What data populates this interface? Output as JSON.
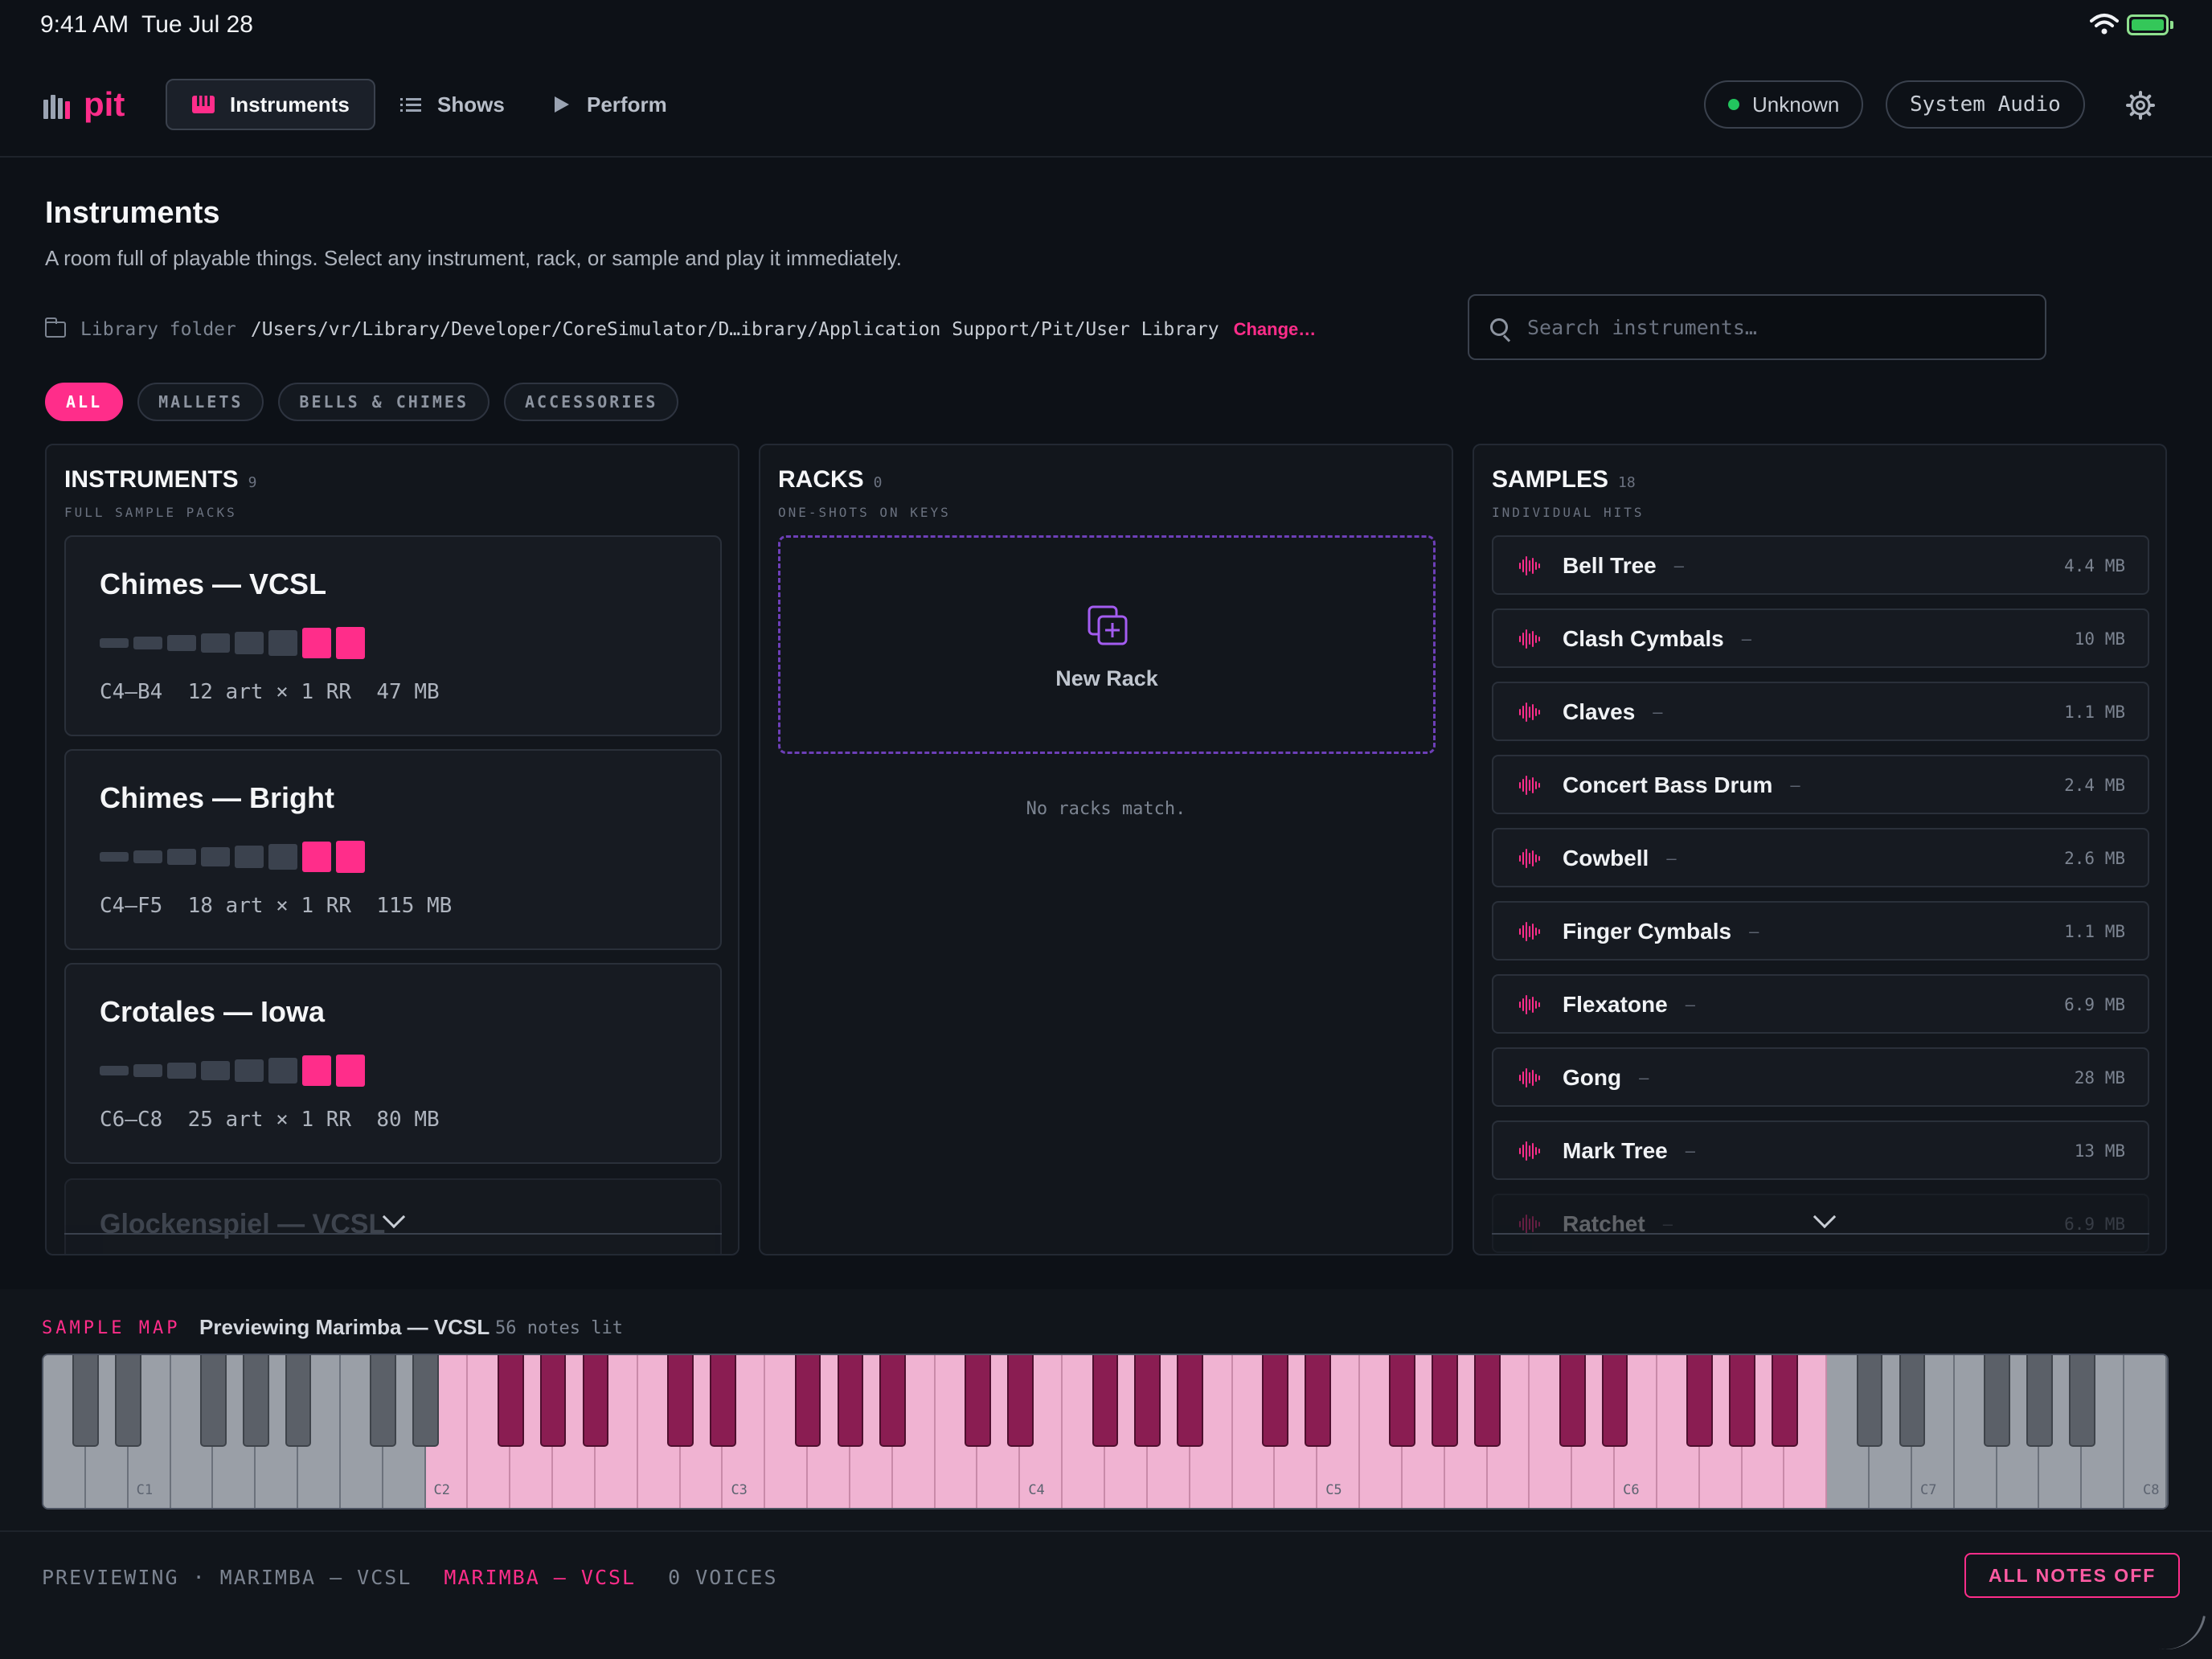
{
  "status": {
    "time": "9:41 AM",
    "date": "Tue Jul 28"
  },
  "nav": {
    "logo": "pit",
    "tabs": [
      {
        "label": "Instruments"
      },
      {
        "label": "Shows"
      },
      {
        "label": "Perform"
      }
    ],
    "connection_label": "Unknown",
    "audio_label": "System Audio",
    "accent_color": "#ff2d8a",
    "status_dot_color": "#22c55e"
  },
  "page": {
    "title": "Instruments",
    "subtitle": "A room full of playable things. Select any instrument, rack, or sample and play it immediately."
  },
  "library": {
    "label": "Library folder",
    "path": "/Users/vr/Library/Developer/CoreSimulator/D…ibrary/Application Support/Pit/User Library",
    "change_label": "Change…"
  },
  "search": {
    "placeholder": "Search instruments…",
    "value": ""
  },
  "filters": [
    {
      "label": "ALL",
      "active": true
    },
    {
      "label": "MALLETS",
      "active": false
    },
    {
      "label": "BELLS & CHIMES",
      "active": false
    },
    {
      "label": "ACCESSORIES",
      "active": false
    }
  ],
  "instruments_panel": {
    "title": "INSTRUMENTS",
    "count": "9",
    "caption": "FULL SAMPLE PACKS",
    "items": [
      {
        "name": "Chimes — VCSL",
        "range": "C4–B4",
        "articulations": "12 art × 1 RR",
        "size": "47 MB"
      },
      {
        "name": "Chimes — Bright",
        "range": "C4–F5",
        "articulations": "18 art × 1 RR",
        "size": "115 MB"
      },
      {
        "name": "Crotales — Iowa",
        "range": "C6–C8",
        "articulations": "25 art × 1 RR",
        "size": "80 MB"
      }
    ],
    "partial_item": "Glockenspiel — VCSL"
  },
  "racks_panel": {
    "title": "RACKS",
    "count": "0",
    "caption": "ONE-SHOTS ON KEYS",
    "new_label": "New Rack",
    "empty_text": "No racks match."
  },
  "samples_panel": {
    "title": "SAMPLES",
    "count": "18",
    "caption": "INDIVIDUAL HITS",
    "items": [
      {
        "name": "Bell Tree",
        "dash": "–",
        "size": "4.4 MB"
      },
      {
        "name": "Clash Cymbals",
        "dash": "–",
        "size": "10 MB"
      },
      {
        "name": "Claves",
        "dash": "–",
        "size": "1.1 MB"
      },
      {
        "name": "Concert Bass Drum",
        "dash": "–",
        "size": "2.4 MB"
      },
      {
        "name": "Cowbell",
        "dash": "–",
        "size": "2.6 MB"
      },
      {
        "name": "Finger Cymbals",
        "dash": "–",
        "size": "1.1 MB"
      },
      {
        "name": "Flexatone",
        "dash": "–",
        "size": "6.9 MB"
      },
      {
        "name": "Gong",
        "dash": "–",
        "size": "28 MB"
      },
      {
        "name": "Mark Tree",
        "dash": "–",
        "size": "13 MB"
      },
      {
        "name": "Ratchet",
        "dash": "–",
        "size": "6.9 MB"
      }
    ]
  },
  "sample_map": {
    "label": "SAMPLE MAP",
    "previewing": "Previewing Marimba — VCSL",
    "notes_lit": "56 notes lit",
    "octave_labels": [
      "C1",
      "C2",
      "C3",
      "C4",
      "C5",
      "C6",
      "C7",
      "C8"
    ],
    "lit_from_white_key": 9,
    "lit_to_white_key": 41,
    "total_white_keys": 50,
    "lit_color": "#f0b3d2",
    "lit_black_color": "#8a1d52"
  },
  "footer": {
    "previewing": "PREVIEWING · MARIMBA — VCSL",
    "instrument": "MARIMBA — VCSL",
    "voices": "0 VOICES",
    "all_notes_off": "ALL NOTES OFF"
  }
}
